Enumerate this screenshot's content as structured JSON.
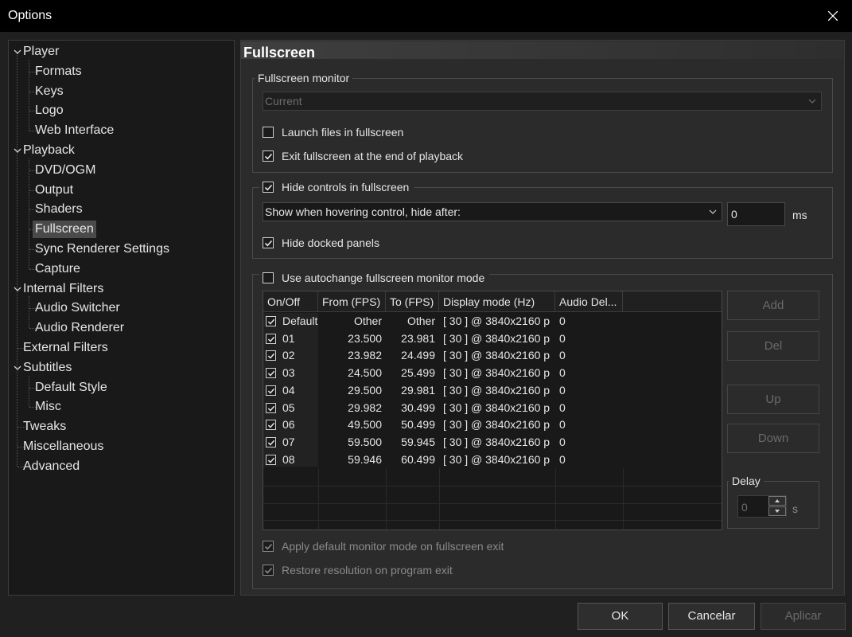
{
  "window": {
    "title": "Options"
  },
  "tree": [
    {
      "label": "Player",
      "level": 0,
      "expanded": true
    },
    {
      "label": "Formats",
      "level": 1
    },
    {
      "label": "Keys",
      "level": 1
    },
    {
      "label": "Logo",
      "level": 1
    },
    {
      "label": "Web Interface",
      "level": 1
    },
    {
      "label": "Playback",
      "level": 0,
      "expanded": true
    },
    {
      "label": "DVD/OGM",
      "level": 1
    },
    {
      "label": "Output",
      "level": 1
    },
    {
      "label": "Shaders",
      "level": 1
    },
    {
      "label": "Fullscreen",
      "level": 1,
      "selected": true
    },
    {
      "label": "Sync Renderer Settings",
      "level": 1
    },
    {
      "label": "Capture",
      "level": 1
    },
    {
      "label": "Internal Filters",
      "level": 0,
      "expanded": true
    },
    {
      "label": "Audio Switcher",
      "level": 1
    },
    {
      "label": "Audio Renderer",
      "level": 1
    },
    {
      "label": "External Filters",
      "level": 0
    },
    {
      "label": "Subtitles",
      "level": 0,
      "expanded": true
    },
    {
      "label": "Default Style",
      "level": 1
    },
    {
      "label": "Misc",
      "level": 1
    },
    {
      "label": "Tweaks",
      "level": 0
    },
    {
      "label": "Miscellaneous",
      "level": 0
    },
    {
      "label": "Advanced",
      "level": 0
    }
  ],
  "page": {
    "title": "Fullscreen",
    "monitor_group": {
      "label": "Fullscreen monitor",
      "monitor_value": "Current",
      "launch_label": "Launch files in fullscreen",
      "launch_checked": false,
      "exit_label": "Exit fullscreen at the end of playback",
      "exit_checked": true
    },
    "hide_group": {
      "label": "Hide controls in fullscreen",
      "checked": true,
      "mode_value": "Show when hovering control, hide after:",
      "delay_value": "0",
      "delay_unit": "ms",
      "docked_label": "Hide docked panels",
      "docked_checked": true
    },
    "autochange_group": {
      "label": "Use autochange fullscreen monitor mode",
      "checked": false,
      "columns": [
        "On/Off",
        "From (FPS)",
        "To (FPS)",
        "Display mode (Hz)",
        "Audio Del..."
      ],
      "rows": [
        {
          "name": "Default",
          "from": "Other",
          "to": "Other",
          "mode": "[ 30 ] @ 3840x2160 p",
          "audio": "0"
        },
        {
          "name": "01",
          "from": "23.500",
          "to": "23.981",
          "mode": "[ 30 ] @ 3840x2160 p",
          "audio": "0"
        },
        {
          "name": "02",
          "from": "23.982",
          "to": "24.499",
          "mode": "[ 30 ] @ 3840x2160 p",
          "audio": "0"
        },
        {
          "name": "03",
          "from": "24.500",
          "to": "25.499",
          "mode": "[ 30 ] @ 3840x2160 p",
          "audio": "0"
        },
        {
          "name": "04",
          "from": "29.500",
          "to": "29.981",
          "mode": "[ 30 ] @ 3840x2160 p",
          "audio": "0"
        },
        {
          "name": "05",
          "from": "29.982",
          "to": "30.499",
          "mode": "[ 30 ] @ 3840x2160 p",
          "audio": "0"
        },
        {
          "name": "06",
          "from": "49.500",
          "to": "50.499",
          "mode": "[ 30 ] @ 3840x2160 p",
          "audio": "0"
        },
        {
          "name": "07",
          "from": "59.500",
          "to": "59.945",
          "mode": "[ 30 ] @ 3840x2160 p",
          "audio": "0"
        },
        {
          "name": "08",
          "from": "59.946",
          "to": "60.499",
          "mode": "[ 30 ] @ 3840x2160 p",
          "audio": "0"
        }
      ],
      "buttons": {
        "add": "Add",
        "del": "Del",
        "up": "Up",
        "down": "Down"
      },
      "delay": {
        "label": "Delay",
        "value": "0",
        "unit": "s"
      },
      "apply_default_label": "Apply default monitor mode on fullscreen exit",
      "restore_label": "Restore resolution on program exit"
    }
  },
  "footer": {
    "ok": "OK",
    "cancel": "Cancelar",
    "apply": "Aplicar"
  },
  "colors": {
    "background": "#202020",
    "panel": "#2b2b2b",
    "titlebar": "#000000",
    "list_bg": "#191919",
    "selection": "#4a4a4a"
  }
}
